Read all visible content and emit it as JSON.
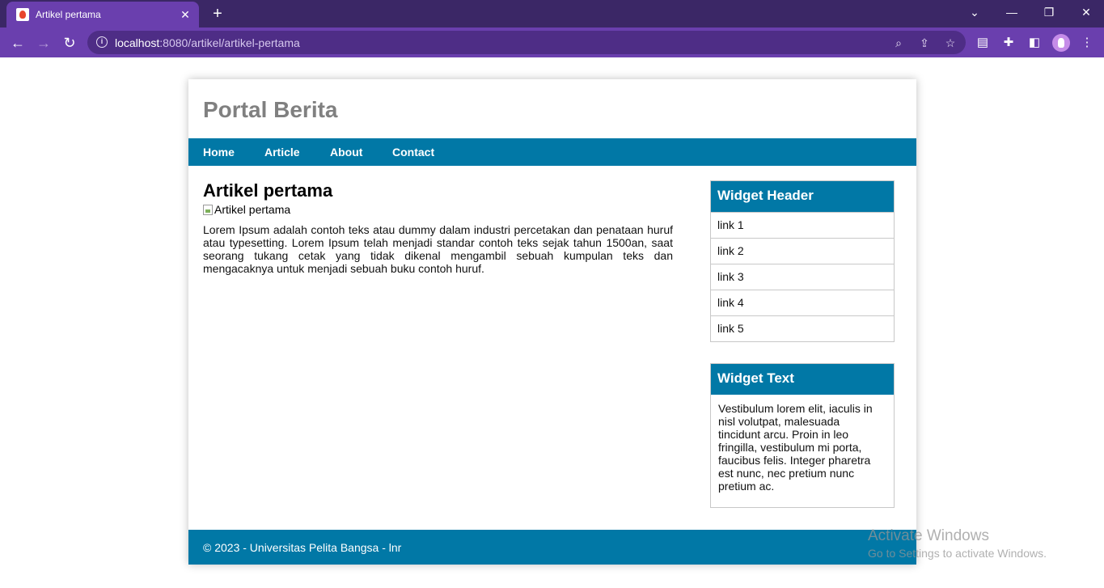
{
  "browser": {
    "tab_title": "Artikel pertama",
    "tab_close": "✕",
    "new_tab": "+",
    "url_host": "localhost",
    "url_rest": ":8080/artikel/artikel-pertama",
    "icons": [
      "back-icon",
      "forward-icon",
      "reload-icon",
      "info-icon",
      "zoom-icon",
      "share-icon",
      "star-icon",
      "extension-icon",
      "puzzle-icon",
      "sidebar-icon",
      "profile-avatar",
      "menu-icon"
    ]
  },
  "site": {
    "title": "Portal Berita",
    "nav": [
      "Home",
      "Article",
      "About",
      "Contact"
    ]
  },
  "article": {
    "title": "Artikel pertama",
    "image_alt": "Artikel pertama",
    "body": "Lorem Ipsum adalah contoh teks atau dummy dalam industri percetakan dan penataan huruf atau typesetting. Lorem Ipsum telah menjadi standar contoh teks sejak tahun 1500an, saat seorang tukang cetak yang tidak dikenal mengambil sebuah kumpulan teks dan mengacaknya untuk menjadi sebuah buku contoh huruf."
  },
  "sidebar": {
    "widget_header": {
      "title": "Widget Header",
      "links": [
        "link 1",
        "link 2",
        "link 3",
        "link 4",
        "link 5"
      ]
    },
    "widget_text": {
      "title": "Widget Text",
      "body": "Vestibulum lorem elit, iaculis in nisl volutpat, malesuada tincidunt arcu. Proin in leo fringilla, vestibulum mi porta, faucibus felis. Integer pharetra est nunc, nec pretium nunc pretium ac."
    }
  },
  "footer": {
    "text": "© 2023 - Universitas Pelita Bangsa - lnr"
  },
  "watermark": {
    "title": "Activate Windows",
    "subtitle": "Go to Settings to activate Windows."
  },
  "colors": {
    "accent": "#0178a6",
    "chrome_frame": "#3b2766",
    "chrome_toolbar": "#6a3fae"
  }
}
